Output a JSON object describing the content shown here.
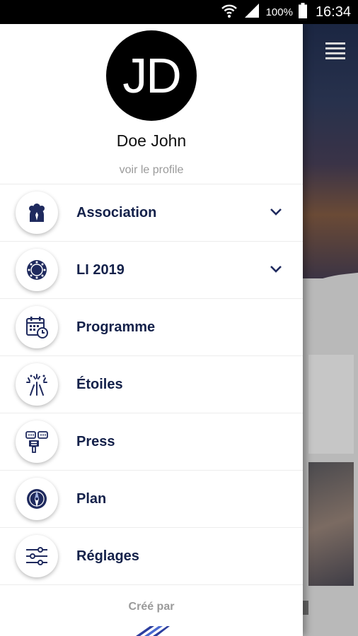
{
  "status_bar": {
    "battery_percent": "100%",
    "time": "16:34",
    "icons": [
      "wifi-icon",
      "signal-icon",
      "battery-icon"
    ]
  },
  "drawer": {
    "avatar_initials": "JD",
    "user_name": "Doe John",
    "profile_link": "voir le profile",
    "menu": [
      {
        "label": "Association",
        "icon": "association-icon",
        "expandable": true
      },
      {
        "label": "LI 2019",
        "icon": "lions-emblem-icon",
        "expandable": true
      },
      {
        "label": "Programme",
        "icon": "calendar-clock-icon",
        "expandable": false
      },
      {
        "label": "Étoiles",
        "icon": "fireworks-icon",
        "expandable": false
      },
      {
        "label": "Press",
        "icon": "press-chat-icon",
        "expandable": false
      },
      {
        "label": "Plan",
        "icon": "compass-icon",
        "expandable": false
      },
      {
        "label": "Réglages",
        "icon": "sliders-icon",
        "expandable": false
      }
    ],
    "footer_label": "Créé par"
  },
  "colors": {
    "label": "#14214a",
    "icon": "#1f2a5e",
    "muted": "#9a9a9a"
  }
}
